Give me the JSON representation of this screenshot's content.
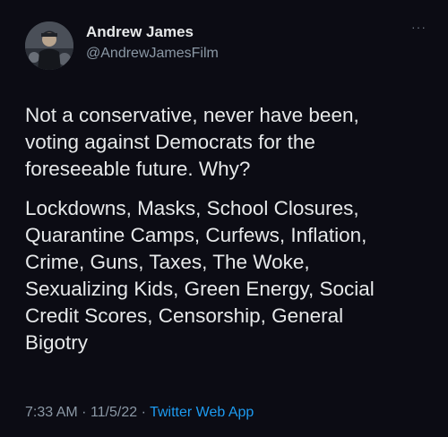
{
  "author": {
    "name": "Andrew James",
    "handle": "@AndrewJamesFilm"
  },
  "menu": {
    "more_icon": "more-horizontal-icon",
    "label": "···"
  },
  "tweet": {
    "paragraph1": "Not a conservative, never have been,\nvoting against Democrats for the\nforeseeable future. Why?",
    "paragraph2": "Lockdowns, Masks, School Closures,\nQuarantine Camps, Curfews, Inflation,\nCrime, Guns, Taxes, The Woke,\nSexualizing Kids, Green Energy, Social\nCredit Scores, Censorship, General\nBigotry"
  },
  "meta": {
    "time": "7:33 AM",
    "separator": "·",
    "date": "11/5/22",
    "source": "Twitter Web App"
  },
  "colors": {
    "background": "#0c0c14",
    "text": "#e7e9ea",
    "secondary": "#8b98a5",
    "link": "#1d9bf0"
  }
}
